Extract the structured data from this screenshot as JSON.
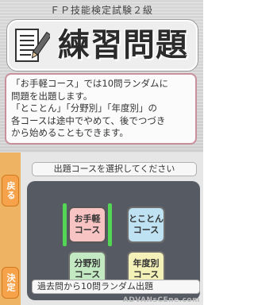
{
  "top_screen": {
    "exam_title": "ＦＰ技能検定試験２級",
    "banner_title": "練習問題",
    "description_lines": [
      "「お手軽コース」では10問ランダムに",
      "問題を出題します。",
      "「とことん」「分野別」「年度別」の",
      "各コースは途中でやめて、後でつづき",
      "から始めることもできます。"
    ]
  },
  "bottom_screen": {
    "back_label": "戻る",
    "confirm_label": "決定",
    "instruction": "出題コースを選択してください",
    "courses": [
      {
        "line1": "お手軽",
        "line2": "コース",
        "color": "#f8c3c3",
        "selected": true
      },
      {
        "line1": "とことん",
        "line2": "コース",
        "color": "#bfe2f2",
        "selected": false
      },
      {
        "line1": "分野別",
        "line2": "コース",
        "color": "#c3e9c3",
        "selected": false
      },
      {
        "line1": "年度別",
        "line2": "コース",
        "color": "#f4f1b8",
        "selected": false
      }
    ],
    "status_text": "過去問から10問ランダム出題"
  },
  "watermark": "ADVANsCEne.com",
  "colors": {
    "side_button": "#f6a24a",
    "selection": "#53d653",
    "panel": "#555a63",
    "description_border": "#c98f9a"
  }
}
